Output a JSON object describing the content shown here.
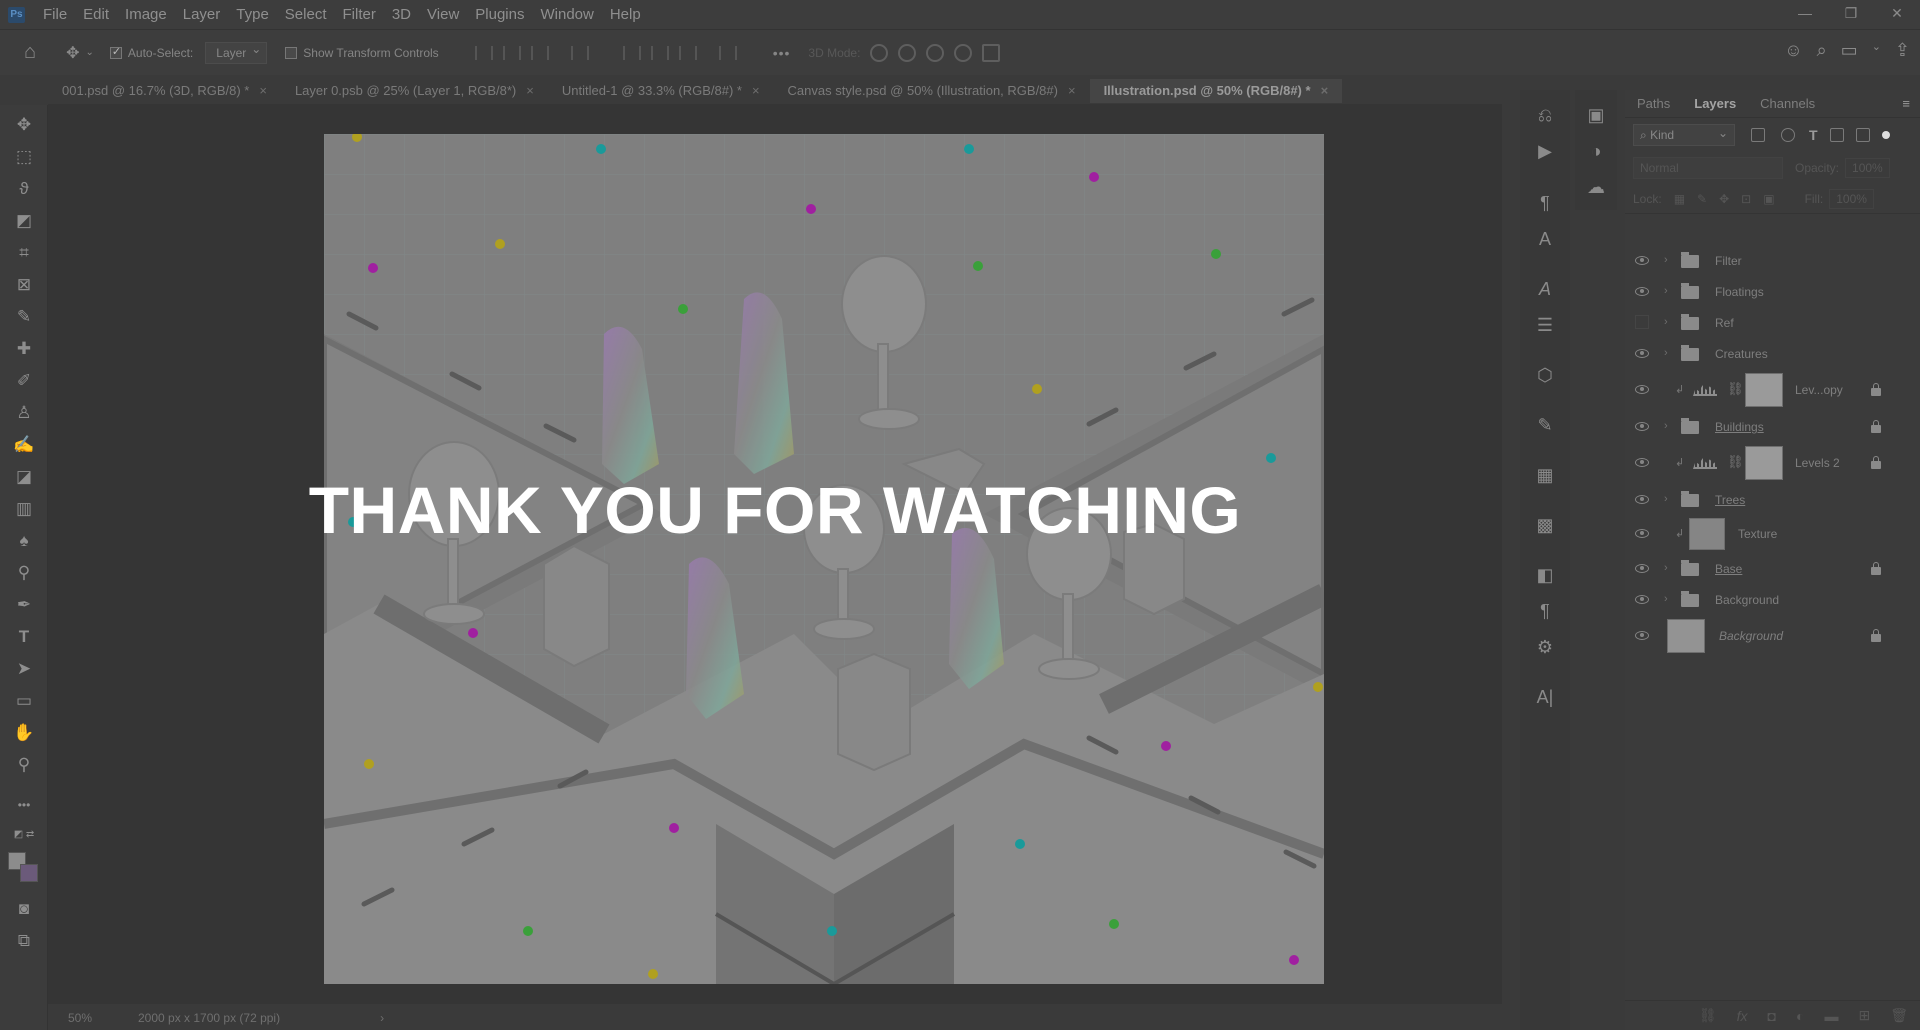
{
  "app": {
    "logo": "Ps"
  },
  "menu": [
    "File",
    "Edit",
    "Image",
    "Layer",
    "Type",
    "Select",
    "Filter",
    "3D",
    "View",
    "Plugins",
    "Window",
    "Help"
  ],
  "window_controls": [
    "—",
    "❐",
    "✕"
  ],
  "options": {
    "auto_select_label": "Auto-Select:",
    "auto_select_checked": true,
    "auto_select_target": "Layer",
    "show_transform_label": "Show Transform Controls",
    "mode_3d_label": "3D Mode:",
    "more": "•••"
  },
  "doc_tabs": [
    {
      "label": "001.psd @ 16.7% (3D, RGB/8) *",
      "active": false
    },
    {
      "label": "Layer 0.psb @ 25% (Layer 1, RGB/8*)",
      "active": false
    },
    {
      "label": "Untitled-1 @ 33.3% (RGB/8#) *",
      "active": false
    },
    {
      "label": "Canvas style.psd @ 50% (Illustration, RGB/8#)",
      "active": false
    },
    {
      "label": "Illustration.psd @ 50% (RGB/8#) *",
      "active": true
    }
  ],
  "tab_close": "×",
  "overlay_text": "THANK YOU FOR WATCHING",
  "status": {
    "zoom": "50%",
    "doc_info": "2000 px x 1700 px (72 ppi)",
    "arrow": "›"
  },
  "layers_panel": {
    "tabs": [
      "Paths",
      "Layers",
      "Channels"
    ],
    "active_tab": "Layers",
    "kind_filter": "Kind",
    "blend_mode": "Normal",
    "opacity_label": "Opacity:",
    "opacity_value": "100%",
    "lock_label": "Lock:",
    "fill_label": "Fill:",
    "fill_value": "100%",
    "layers": [
      {
        "name": "Filter",
        "type": "group",
        "visible": true,
        "locked": false
      },
      {
        "name": "Floatings",
        "type": "group",
        "visible": true,
        "locked": false
      },
      {
        "name": "Ref",
        "type": "group",
        "visible": false,
        "locked": false
      },
      {
        "name": "Creatures",
        "type": "group",
        "visible": true,
        "locked": false
      },
      {
        "name": "Lev...opy",
        "type": "adjustment",
        "visible": true,
        "locked": true
      },
      {
        "name": "Buildings",
        "type": "group",
        "visible": true,
        "locked": true
      },
      {
        "name": "Levels 2",
        "type": "adjustment",
        "visible": true,
        "locked": true
      },
      {
        "name": "Trees",
        "type": "group",
        "visible": true,
        "locked": false
      },
      {
        "name": "Texture",
        "type": "pixel",
        "visible": true,
        "locked": false
      },
      {
        "name": "Base",
        "type": "group",
        "visible": true,
        "locked": true
      },
      {
        "name": "Background",
        "type": "group",
        "visible": true,
        "locked": false
      },
      {
        "name": "Background",
        "type": "background",
        "visible": true,
        "locked": true
      }
    ]
  },
  "colors": {
    "accent_teal": "#1a9a9a",
    "accent_magenta": "#a020a0",
    "accent_green": "#3aa03a",
    "accent_yellow": "#b0a020",
    "overlay_text": "#ffffff"
  }
}
